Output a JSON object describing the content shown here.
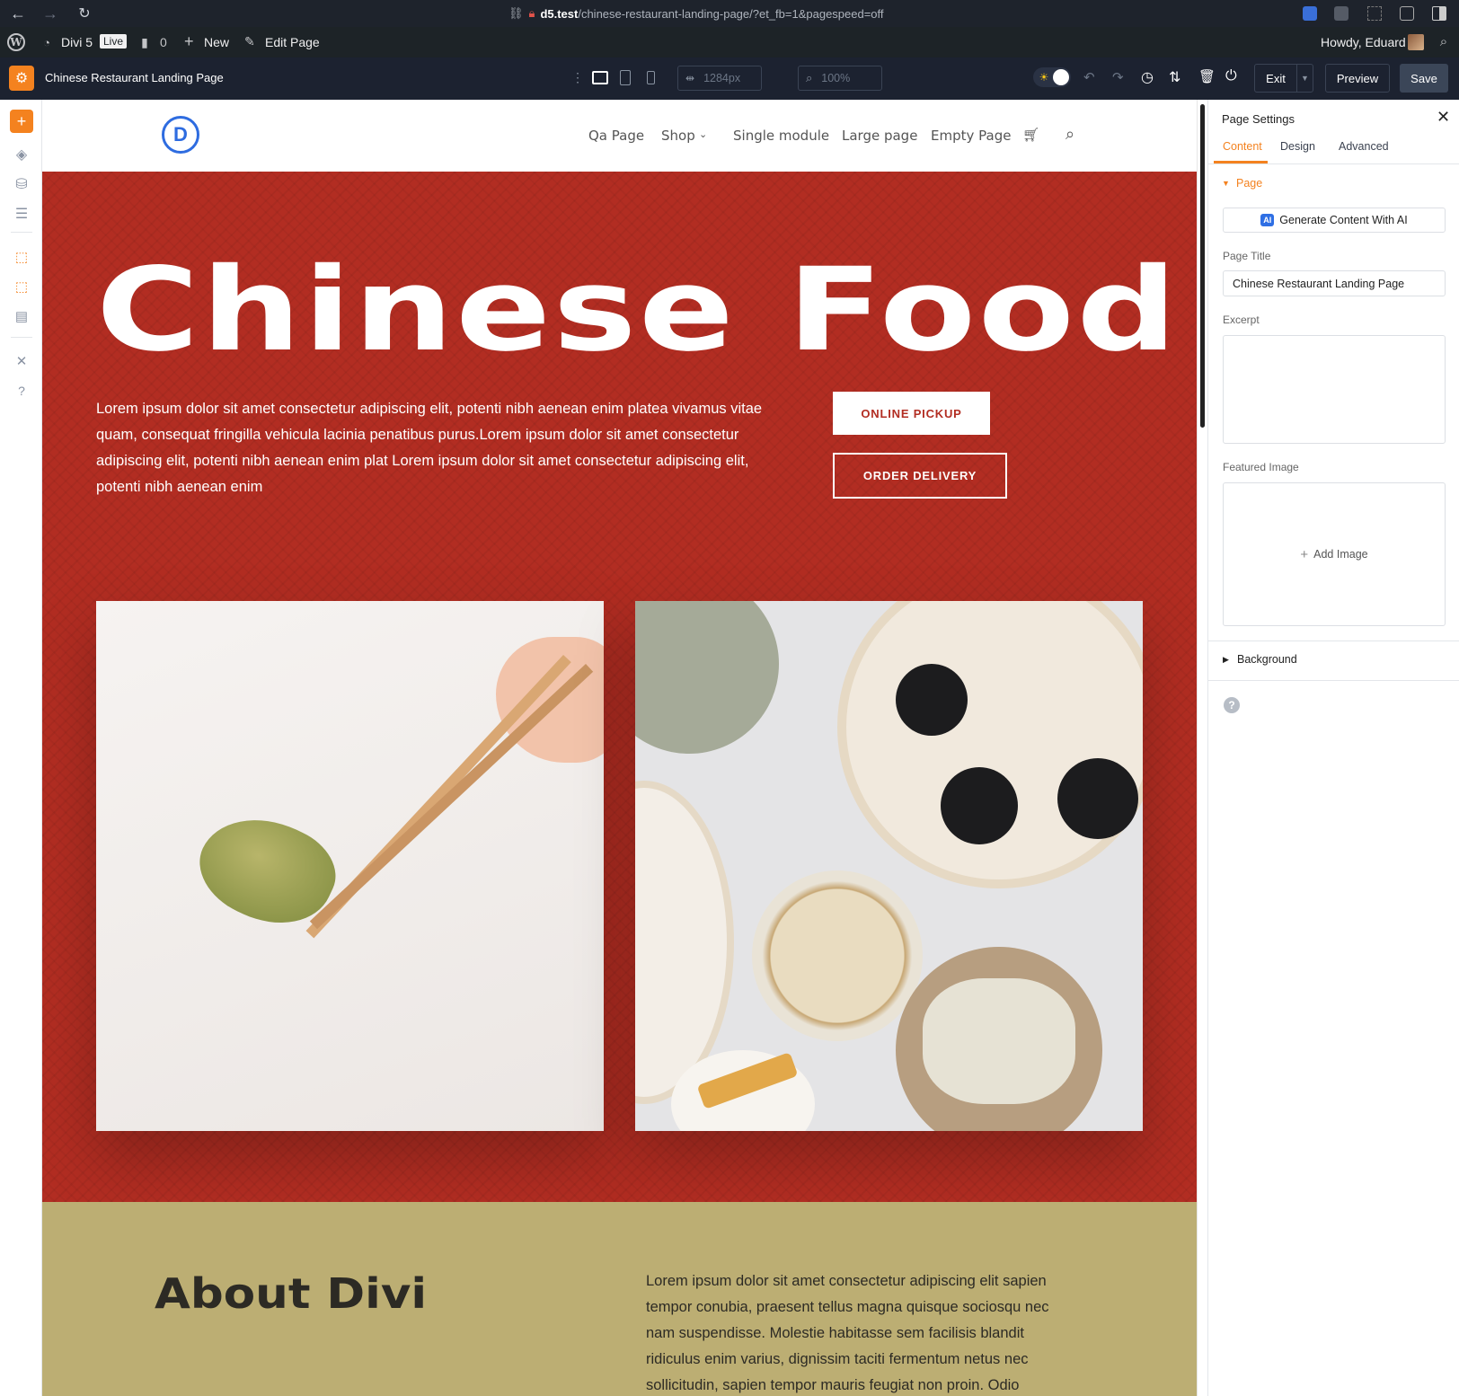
{
  "browser": {
    "url_host": "d5.test",
    "url_path": "/chinese-restaurant-landing-page/?et_fb=1&pagespeed=off"
  },
  "wpbar": {
    "site_name": "Divi 5",
    "live_badge": "Live",
    "comments_count": "0",
    "new_label": "New",
    "edit_label": "Edit Page",
    "howdy": "Howdy, Eduard"
  },
  "divibar": {
    "page_title": "Chinese Restaurant Landing Page",
    "width_value": "1284px",
    "zoom_value": "100%",
    "exit_label": "Exit",
    "preview_label": "Preview",
    "save_label": "Save",
    "colors": {
      "accent": "#f4821f",
      "save_bg": "#3b4658"
    }
  },
  "site": {
    "logo_letter": "D",
    "nav": [
      "Qa Page",
      "Shop",
      "Single module",
      "Large page",
      "Empty Page"
    ],
    "hero_title": "Chinese Food",
    "hero_text": "Lorem ipsum dolor sit amet consectetur adipiscing elit, potenti nibh aenean enim platea vivamus vitae quam, consequat fringilla vehicula lacinia penatibus purus.Lorem ipsum dolor sit amet consectetur adipiscing elit, potenti nibh aenean enim plat Lorem ipsum dolor sit amet consectetur adipiscing elit, potenti nibh aenean enim",
    "btn_pickup": "ONLINE PICKUP",
    "btn_delivery": "ORDER DELIVERY",
    "about_title": "About Divi",
    "about_text": "Lorem ipsum dolor sit amet consectetur adipiscing elit sapien tempor conubia, praesent tellus magna quisque sociosqu nec nam suspendisse. Molestie habitasse sem facilisis blandit ridiculus enim varius, dignissim taciti fermentum netus nec sollicitudin, sapien tempor mauris feugiat non proin. Odio",
    "colors": {
      "hero_red": "#b22d22",
      "about_gold": "#bcae73",
      "logo_blue": "#2e6ce0"
    }
  },
  "panel": {
    "title": "Page Settings",
    "tabs": [
      "Content",
      "Design",
      "Advanced"
    ],
    "section_page": "Page",
    "ai_button": "Generate Content With AI",
    "ai_badge": "AI",
    "page_title_label": "Page Title",
    "page_title_value": "Chinese Restaurant Landing Page",
    "excerpt_label": "Excerpt",
    "excerpt_value": "",
    "featured_label": "Featured Image",
    "add_image": "Add Image",
    "section_background": "Background"
  }
}
